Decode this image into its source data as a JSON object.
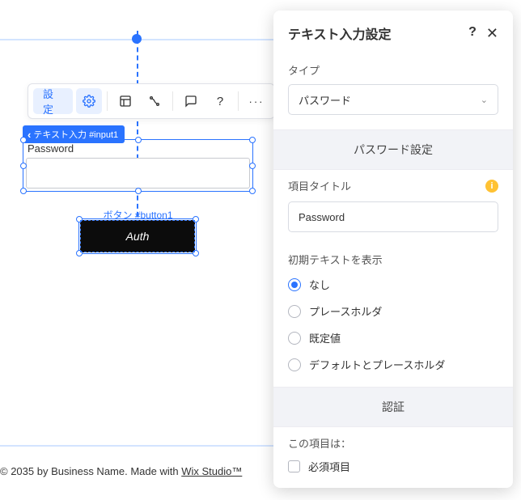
{
  "toolbar": {
    "settings_label": "設定"
  },
  "canvas": {
    "input_tag": "テキスト入力 #input1",
    "input_label": "Password",
    "button_tag": "ボタン #button1",
    "button_text": "Auth"
  },
  "footer": {
    "text_prefix": "© 2035 by Business Name. Made with ",
    "link": "Wix Studio™"
  },
  "panel": {
    "title": "テキスト入力設定",
    "type_label": "タイプ",
    "type_value": "パスワード",
    "band_password": "パスワード設定",
    "item_title_label": "項目タイトル",
    "item_title_value": "Password",
    "initial_text_label": "初期テキストを表示",
    "radio": {
      "none": "なし",
      "placeholder": "プレースホルダ",
      "default": "既定値",
      "both": "デフォルトとプレースホルダ"
    },
    "band_auth": "認証",
    "this_item_label": "この項目は：",
    "required_label": "必須項目"
  }
}
